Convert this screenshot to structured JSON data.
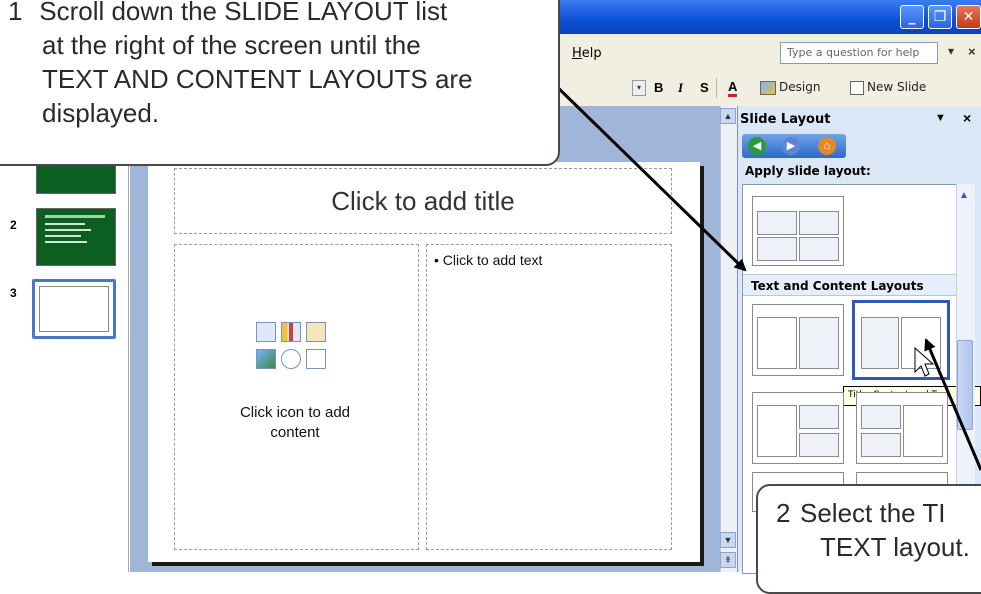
{
  "window": {
    "min_glyph": "_",
    "max_glyph": "❐",
    "close_glyph": "✕"
  },
  "menubar": {
    "help_label": "Help",
    "help_input_placeholder": "Type a question for help",
    "help_dropdown_glyph": "▾",
    "help_close_glyph": "×"
  },
  "formatting_toolbar": {
    "dropdown_glyph": "▾",
    "bold_label": "B",
    "italic_label": "I",
    "shadow_label": "S",
    "font_color_label": "A",
    "design_label": "Design",
    "new_slide_label": "New Slide"
  },
  "thumbnails": {
    "numbers": [
      "2",
      "3"
    ]
  },
  "slide": {
    "title_placeholder": "Click to add title",
    "bullet_text": "Click to add text",
    "content_hint_line1": "Click icon to add",
    "content_hint_line2": "content"
  },
  "task_pane": {
    "title": "Slide Layout",
    "dropdown_glyph": "▼",
    "close_glyph": "×",
    "apply_label": "Apply slide layout:",
    "section_label": "Text and Content Layouts",
    "tooltip": "Title, Content and Text"
  },
  "callouts": {
    "step1_number": "1",
    "step1_line1": "Scroll down the SLIDE LAYOUT list",
    "step1_line2": "at the right of the screen until the",
    "step1_line3": "TEXT AND CONTENT LAYOUTS are",
    "step1_line4": "displayed.",
    "step2_number": "2",
    "step2_line1": "Select the TI",
    "step2_line2": "TEXT layout."
  },
  "colors": {
    "titlebar": "#0a4fd6",
    "toolbar_bg": "#f1efe2",
    "task_pane_bg": "#dbe6f7",
    "slide_workspace": "#9fb6d8",
    "thumbnail_green": "#0d5e21",
    "selection_blue": "#2e57b8"
  }
}
